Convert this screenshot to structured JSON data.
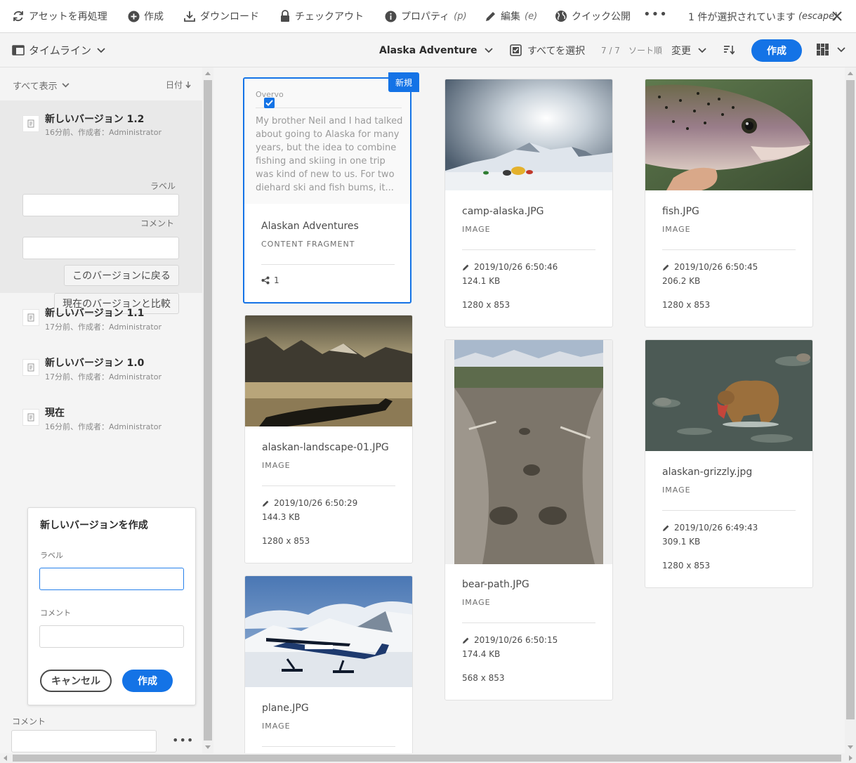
{
  "actionbar": {
    "reprocess": "アセットを再処理",
    "create": "作成",
    "download": "ダウンロード",
    "checkout": "チェックアウト",
    "properties": "プロパティ",
    "properties_shortcut": "(p)",
    "edit": "編集",
    "edit_shortcut": "(e)",
    "quick_publish": "クイック公開",
    "more": "•••",
    "selection_status": "1 件が選択されています",
    "escape_hint": "(escape)"
  },
  "secondbar": {
    "rail_toggle": "タイムライン",
    "breadcrumb": "Alaska Adventure",
    "select_all": "すべてを選択",
    "count": "7 / 7",
    "sort_label": "ソート順",
    "sort_value": "変更",
    "create": "作成"
  },
  "rail": {
    "filter": "すべて表示",
    "date_sort": "日付",
    "versions": [
      {
        "title": "新しいバージョン 1.2",
        "meta": "16分前、作成者：Administrator"
      },
      {
        "title": "新しいバージョン 1.1",
        "meta": "17分前、作成者：Administrator"
      },
      {
        "title": "新しいバージョン 1.0",
        "meta": "17分前、作成者：Administrator"
      },
      {
        "title": "現在",
        "meta": "16分前、作成者：Administrator"
      }
    ],
    "expanded": {
      "label_caption": "ラベル",
      "comment_caption": "コメント",
      "revert_button": "このバージョンに戻る",
      "compare_button": "現在のバージョンと比較"
    },
    "create_version": {
      "title": "新しいバージョンを作成",
      "label_caption": "ラベル",
      "comment_caption": "コメント",
      "cancel": "キャンセル",
      "create": "作成"
    },
    "bottom_comment_label": "コメント",
    "bottom_more": "•••"
  },
  "cards": [
    {
      "name": "Alaskan Adventures",
      "type": "CONTENT FRAGMENT",
      "badge": "新規",
      "preview_head": "Overvo",
      "preview_text": "My brother Neil and I had talked about going to Alaska for many years, but the idea to combine fishing and skiing in one trip was kind of new to us. For two diehard ski and fish bums, it...",
      "shares": "1"
    },
    {
      "name": "camp-alaska.JPG",
      "type": "IMAGE",
      "date": "2019/10/26 6:50:46",
      "size": "124.1 KB",
      "dim": "1280 x 853"
    },
    {
      "name": "fish.JPG",
      "type": "IMAGE",
      "date": "2019/10/26 6:50:45",
      "size": "206.2 KB",
      "dim": "1280 x 853"
    },
    {
      "name": "alaskan-landscape-01.JPG",
      "type": "IMAGE",
      "date": "2019/10/26 6:50:29",
      "size": "144.3 KB",
      "dim": "1280 x 853"
    },
    {
      "name": "bear-path.JPG",
      "type": "IMAGE",
      "date": "2019/10/26 6:50:15",
      "size": "174.4 KB",
      "dim": "568 x 853"
    },
    {
      "name": "alaskan-grizzly.jpg",
      "type": "IMAGE",
      "date": "2019/10/26 6:49:43",
      "size": "309.1 KB",
      "dim": "1280 x 853"
    },
    {
      "name": "plane.JPG",
      "type": "IMAGE"
    }
  ],
  "colors": {
    "accent": "#1473e6",
    "background": "#f4f4f4"
  }
}
